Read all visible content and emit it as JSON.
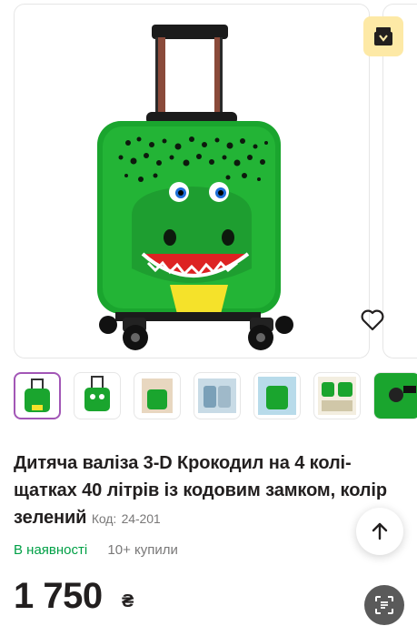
{
  "product": {
    "title": "Дитяча валіза 3-D Крокодил на 4 колі-щатках 40 літрів із кодовим замком, колір зелений",
    "code_label": "Код:",
    "code_value": "24-201",
    "availability": "В наявності",
    "bought_count": "10+ купили",
    "price": "1 750",
    "currency": "₴"
  },
  "gallery": {
    "thumbnail_count": 7,
    "active_thumbnail": 1
  },
  "colors": {
    "in_stock": "#00a046",
    "active_thumb_border": "#a256b6",
    "suitcase_green": "#1aa52e",
    "promo_badge_bg": "#fde9a6"
  },
  "icons": {
    "promo": "gift-box-icon",
    "wishlist": "heart-icon",
    "scroll_up": "arrow-up-icon",
    "scan": "scan-text-icon"
  }
}
